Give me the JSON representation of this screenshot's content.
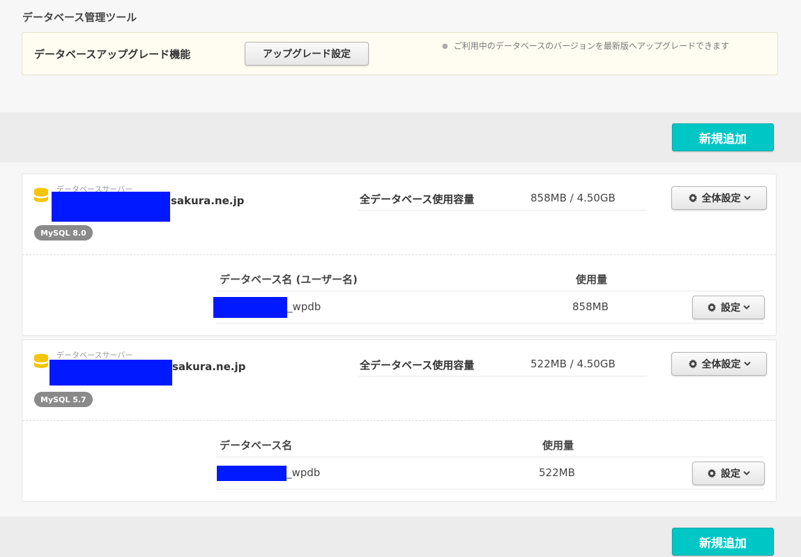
{
  "page": {
    "title": "データベース管理ツール"
  },
  "upgrade": {
    "label": "データベースアップグレード機能",
    "button_label": "アップグレード設定",
    "note": "ご利用中のデータベースのバージョンを最新版へアップグレードできます"
  },
  "add_button_label": "新規追加",
  "servers": [
    {
      "caption": "データベースサーバー",
      "hostname_suffix": "sakura.ne.jp",
      "version_badge": "MySQL 8.0",
      "usage_label": "全データベース使用容量",
      "usage_value": "858MB / 4.50GB",
      "settings_button_label": "全体設定",
      "table": {
        "name_header": "データベース名 (ユーザー名)",
        "usage_header": "使用量",
        "rows": [
          {
            "name_suffix": "_wpdb",
            "usage": "858MB",
            "settings_label": "設定"
          }
        ]
      }
    },
    {
      "caption": "データベースサーバー",
      "hostname_suffix": "sakura.ne.jp",
      "version_badge": "MySQL 5.7",
      "usage_label": "全データベース使用容量",
      "usage_value": "522MB / 4.50GB",
      "settings_button_label": "全体設定",
      "table": {
        "name_header": "データベース名",
        "usage_header": "使用量",
        "rows": [
          {
            "name_suffix": "_wpdb",
            "usage": "522MB",
            "settings_label": "設定"
          }
        ]
      }
    }
  ],
  "colors": {
    "accent": "#00c6c6",
    "redaction": "#0019ff",
    "db_icon": "#f5c400",
    "badge": "#8a8a8a"
  }
}
